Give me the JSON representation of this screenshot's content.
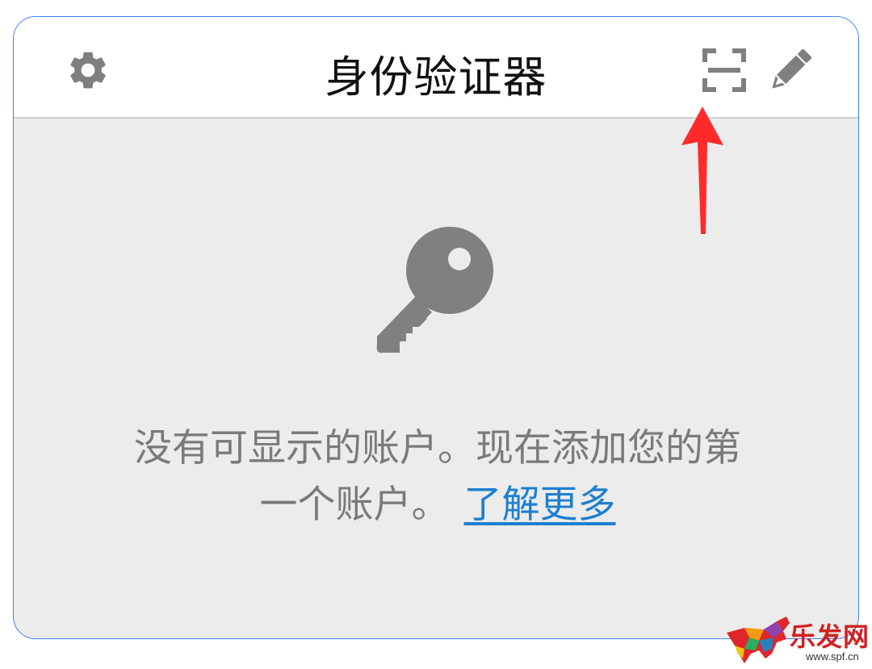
{
  "header": {
    "title": "身份验证器",
    "left_icon": "gear-icon",
    "right_icons": [
      "qr-scan-icon",
      "pencil-icon"
    ]
  },
  "empty_state": {
    "icon": "key-icon",
    "message": "没有可显示的账户。现在添加您的第一个账户。",
    "message_line1": "没有可显示的账户。现在添加您的第",
    "message_line2": "一个账户。",
    "link_label": "了解更多"
  },
  "annotation": {
    "icon": "red-arrow-icon",
    "color": "#ff2b2b"
  },
  "watermark": {
    "logo_icon": "colorful-bull-logo",
    "name": "乐发网",
    "url": "www.spf.cn"
  },
  "colors": {
    "panel_border": "#3b82f6",
    "header_bg": "#ffffff",
    "body_bg": "#ececec",
    "icon_gray": "#7f7f7f",
    "text_gray": "#7a7a7a",
    "link_blue": "#1e7fd0"
  }
}
